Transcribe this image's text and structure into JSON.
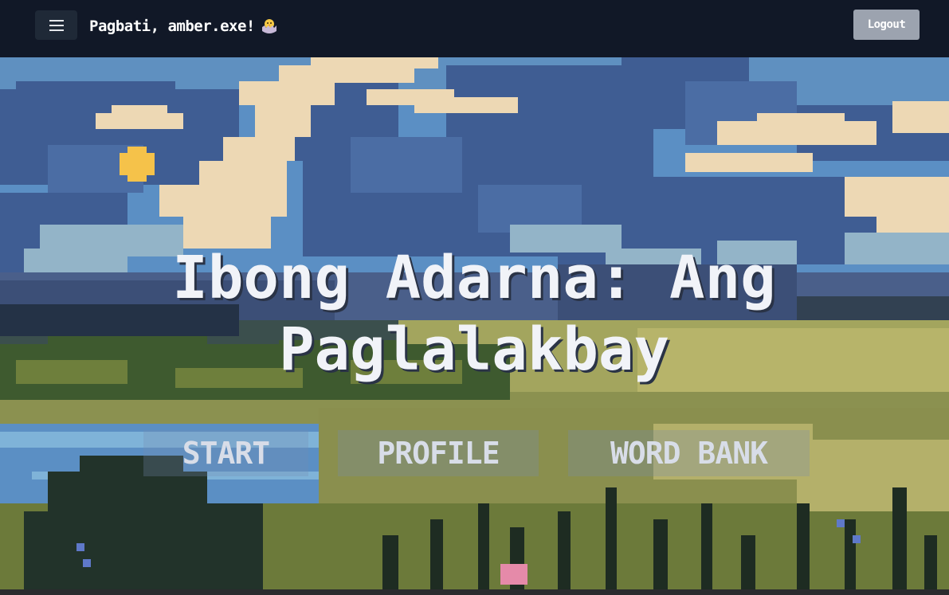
{
  "header": {
    "greeting": "Pagbati, amber.exe!",
    "menu_icon": "hamburger-menu-icon",
    "avatar_icon": "hatching-chick-icon",
    "logout_label": "Logout"
  },
  "hero": {
    "title": "Ibong Adarna: Ang Paglalakbay",
    "buttons": [
      {
        "label": "START"
      },
      {
        "label": "PROFILE"
      },
      {
        "label": "WORD BANK"
      }
    ]
  },
  "colors": {
    "topbar": "#111827",
    "logout_bg": "#9ca3af",
    "title_text": "#f1f3f8"
  }
}
